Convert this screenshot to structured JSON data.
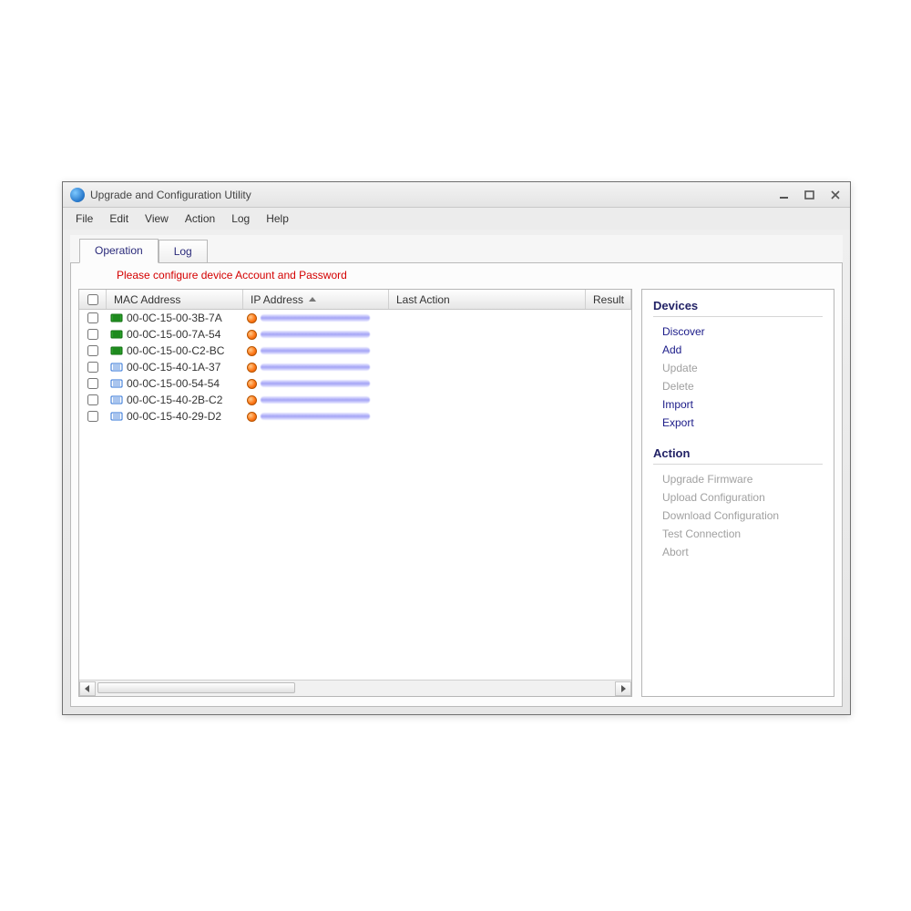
{
  "window": {
    "title": "Upgrade and Configuration Utility"
  },
  "menubar": [
    "File",
    "Edit",
    "View",
    "Action",
    "Log",
    "Help"
  ],
  "tabs": [
    {
      "label": "Operation",
      "active": true
    },
    {
      "label": "Log",
      "active": false
    }
  ],
  "warning": "Please configure device Account and Password",
  "columns": {
    "mac": "MAC Address",
    "ip": "IP Address",
    "last": "Last Action",
    "result": "Result"
  },
  "rows": [
    {
      "mac": "00-0C-15-00-3B-7A",
      "iconKind": "green"
    },
    {
      "mac": "00-0C-15-00-7A-54",
      "iconKind": "green"
    },
    {
      "mac": "00-0C-15-00-C2-BC",
      "iconKind": "green"
    },
    {
      "mac": "00-0C-15-40-1A-37",
      "iconKind": "blue"
    },
    {
      "mac": "00-0C-15-00-54-54",
      "iconKind": "blue"
    },
    {
      "mac": "00-0C-15-40-2B-C2",
      "iconKind": "blue"
    },
    {
      "mac": "00-0C-15-40-29-D2",
      "iconKind": "blue"
    }
  ],
  "side": {
    "devices": {
      "heading": "Devices",
      "items": [
        {
          "label": "Discover",
          "enabled": true
        },
        {
          "label": "Add",
          "enabled": true
        },
        {
          "label": "Update",
          "enabled": false
        },
        {
          "label": "Delete",
          "enabled": false
        },
        {
          "label": "Import",
          "enabled": true
        },
        {
          "label": "Export",
          "enabled": true
        }
      ]
    },
    "action": {
      "heading": "Action",
      "items": [
        {
          "label": "Upgrade Firmware",
          "enabled": false
        },
        {
          "label": "Upload Configuration",
          "enabled": false
        },
        {
          "label": "Download Configuration",
          "enabled": false
        },
        {
          "label": "Test Connection",
          "enabled": false
        },
        {
          "label": "Abort",
          "enabled": false
        }
      ]
    }
  }
}
